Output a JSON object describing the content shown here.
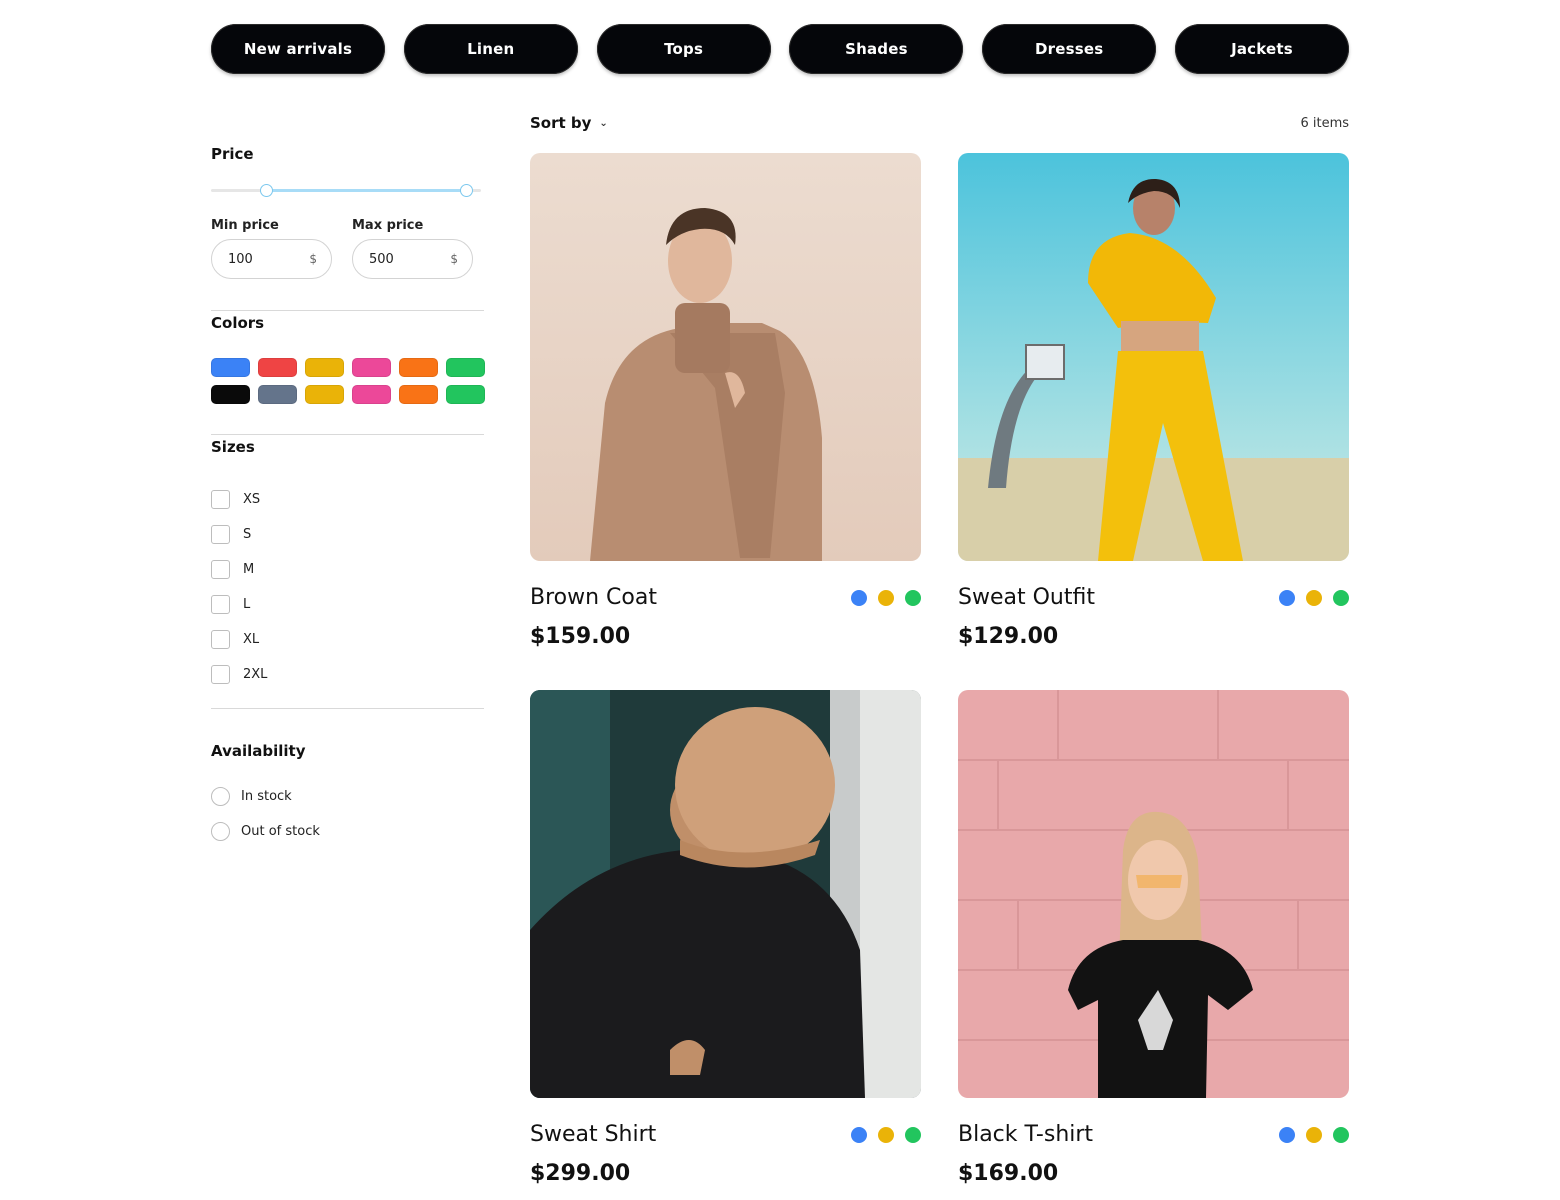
{
  "categories": [
    "New arrivals",
    "Linen",
    "Tops",
    "Shades",
    "Dresses",
    "Jackets"
  ],
  "filters": {
    "price": {
      "title": "Price",
      "min_label": "Min price",
      "max_label": "Max price",
      "min_value": "100",
      "max_value": "500",
      "currency": "$",
      "slider_min_fraction": 0.19,
      "slider_max_fraction": 0.97
    },
    "colors": {
      "title": "Colors",
      "swatches": [
        "#3b82f6",
        "#ef4444",
        "#eab308",
        "#ec4899",
        "#f97316",
        "#22c55e",
        "#0a0a0a",
        "#64748b",
        "#eab308",
        "#ec4899",
        "#f97316",
        "#22c55e"
      ]
    },
    "sizes": {
      "title": "Sizes",
      "options": [
        "XS",
        "S",
        "M",
        "L",
        "XL",
        "2XL"
      ]
    },
    "availability": {
      "title": "Availability",
      "options": [
        "In stock",
        "Out of stock"
      ]
    }
  },
  "toolbar": {
    "sort_label": "Sort by",
    "chevron": "chevron-down-icon",
    "item_count": "6 items"
  },
  "products": [
    {
      "name": "Brown Coat",
      "price": "$159.00",
      "image": "photo-man-brown-coat",
      "colors": [
        "#3b82f6",
        "#eab308",
        "#22c55e"
      ]
    },
    {
      "name": "Sweat Outfit",
      "price": "$129.00",
      "image": "photo-woman-yellow-sweat-outfit",
      "colors": [
        "#3b82f6",
        "#eab308",
        "#22c55e"
      ]
    },
    {
      "name": "Sweat Shirt",
      "price": "$299.00",
      "image": "photo-man-black-sweatshirt-bucket-hat",
      "colors": [
        "#3b82f6",
        "#eab308",
        "#22c55e"
      ]
    },
    {
      "name": "Black T-shirt",
      "price": "$169.00",
      "image": "photo-woman-black-tshirt-pink-wall",
      "colors": [
        "#3b82f6",
        "#eab308",
        "#22c55e"
      ]
    }
  ]
}
